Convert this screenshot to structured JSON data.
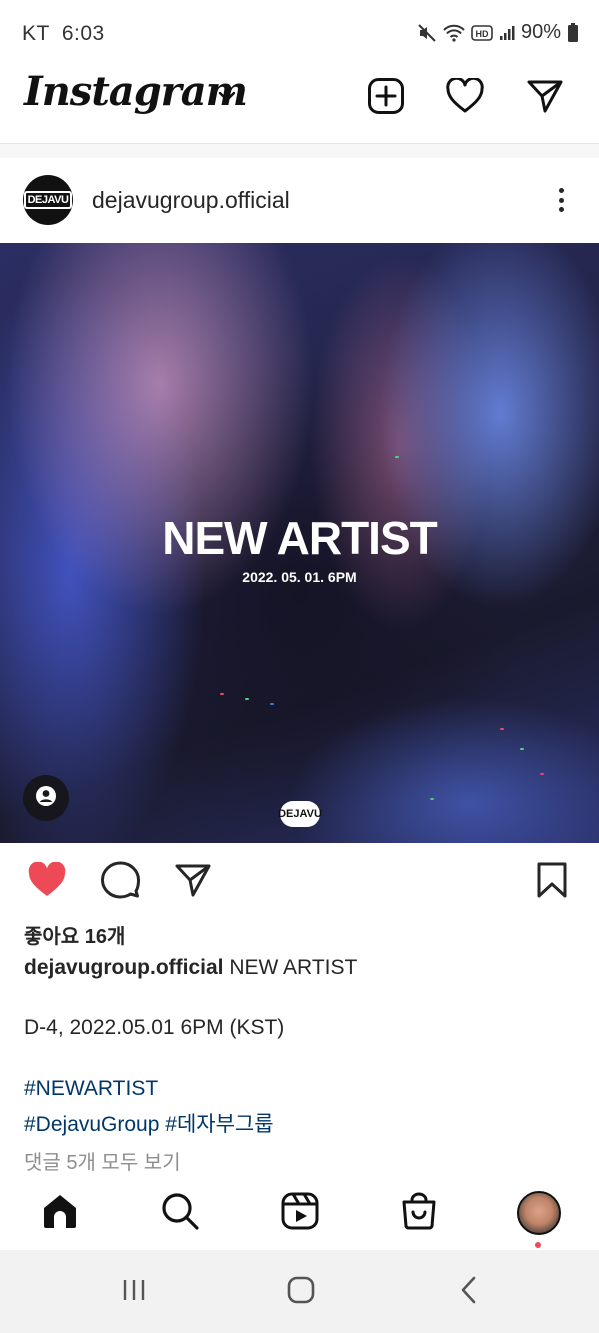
{
  "status_bar": {
    "carrier": "KT",
    "time": "6:03",
    "battery": "90%",
    "icons": [
      "mute-icon",
      "wifi-icon",
      "hd-icon",
      "signal-icon",
      "battery-icon"
    ]
  },
  "header": {
    "logo": "Instagram",
    "icons": [
      "chevron-down-icon",
      "new-post-icon",
      "heart-icon",
      "direct-message-icon"
    ]
  },
  "post": {
    "username": "dejavugroup.official",
    "avatar_text": "DEJAVU",
    "image": {
      "title": "NEW ARTIST",
      "date": "2022. 05. 01. 6PM",
      "logo_text": "DEJAVU"
    },
    "likes_prefix": "좋아요",
    "likes_count": "16개",
    "caption_username": "dejavugroup.official",
    "caption_text": "NEW ARTIST",
    "caption_line2": "D-4, 2022.05.01 6PM (KST)",
    "hashtag1": "#NEWARTIST",
    "hashtag2": "#DejavuGroup",
    "hashtag3": "#데자부그룹",
    "view_comments": "댓글 5개 모두 보기",
    "liked": true
  },
  "bottom_nav": {
    "items": [
      "home-icon",
      "search-icon",
      "reels-icon",
      "shop-icon",
      "profile-avatar"
    ]
  },
  "colors": {
    "like_red": "#ed4956",
    "hashtag_blue": "#00376b",
    "muted_gray": "#8e8e8e"
  }
}
